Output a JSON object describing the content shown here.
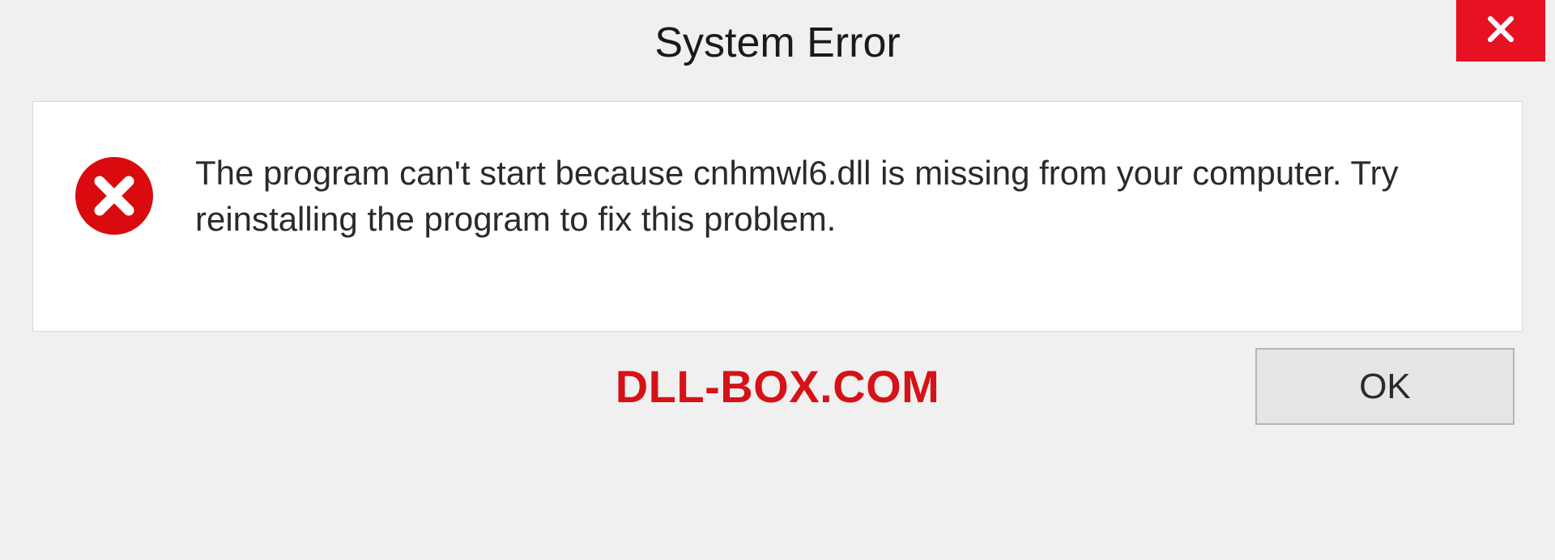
{
  "dialog": {
    "title": "System Error",
    "message": "The program can't start because cnhmwl6.dll is missing from your computer. Try reinstalling the program to fix this problem.",
    "ok_label": "OK"
  },
  "watermark": "DLL-BOX.COM",
  "colors": {
    "accent_red": "#e81123",
    "watermark_red": "#d51217"
  }
}
